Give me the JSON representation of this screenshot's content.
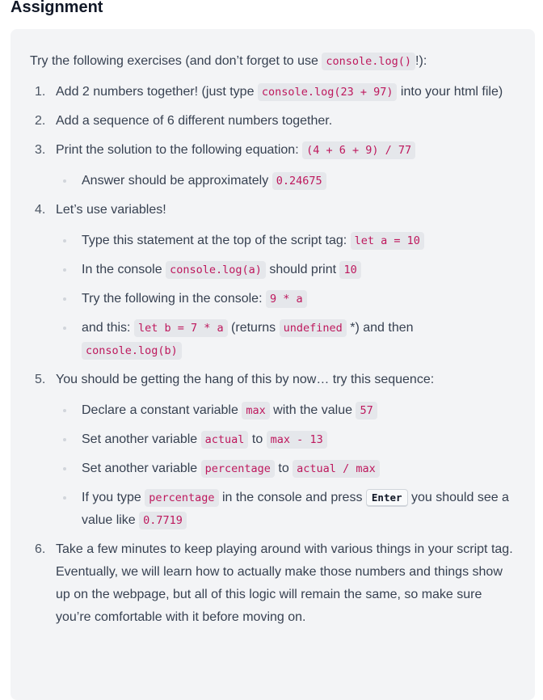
{
  "heading": "Assignment",
  "intro": {
    "before": "Try the following exercises (and don’t forget to use ",
    "code": "console.log()",
    "after": "!):"
  },
  "steps": [
    {
      "number": "1.",
      "t1": "Add 2 numbers together! (just type ",
      "c1": "console.log(23 + 97)",
      "t2": " into your html file)"
    },
    {
      "number": "2.",
      "t1": "Add a sequence of 6 different numbers together."
    },
    {
      "number": "3.",
      "t1": "Print the solution to the following equation: ",
      "c1": "(4 + 6 + 9) / 77",
      "subs": [
        {
          "t1": "Answer should be approximately ",
          "c1": "0.24675"
        }
      ]
    },
    {
      "number": "4.",
      "t1": "Let’s use variables!",
      "subs": [
        {
          "t1": "Type this statement at the top of the script tag: ",
          "c1": "let a = 10"
        },
        {
          "t1": "In the console ",
          "c1": "console.log(a)",
          "t2": " should print ",
          "c2": "10"
        },
        {
          "t1": "Try the following in the console: ",
          "c1": "9 * a"
        },
        {
          "t1": "and this: ",
          "c1": "let b = 7 * a",
          "t2": " (returns ",
          "c2": "undefined",
          "t3": " *) and then ",
          "c3": "console.log(b)"
        }
      ]
    },
    {
      "number": "5.",
      "t1": "You should be getting the hang of this by now… try this sequence:",
      "subs": [
        {
          "t1": "Declare a constant variable ",
          "c1": "max",
          "t2": " with the value ",
          "c2": "57"
        },
        {
          "t1": "Set another variable ",
          "c1": "actual",
          "t2": " to ",
          "c2": "max - 13"
        },
        {
          "t1": "Set another variable ",
          "c1": "percentage",
          "t2": " to ",
          "c2": "actual / max"
        },
        {
          "t1": "If you type ",
          "c1": "percentage",
          "t2": " in the console and press ",
          "k1": "Enter",
          "t3": " you should see a value like ",
          "c2": "0.7719"
        }
      ]
    },
    {
      "number": "6.",
      "t1": "Take a few minutes to keep playing around with various things in your script tag. Eventually, we will learn how to actually make those numbers and things show up on the webpage, but all of this logic will remain the same, so make sure you’re comfortable with it before moving on."
    }
  ]
}
